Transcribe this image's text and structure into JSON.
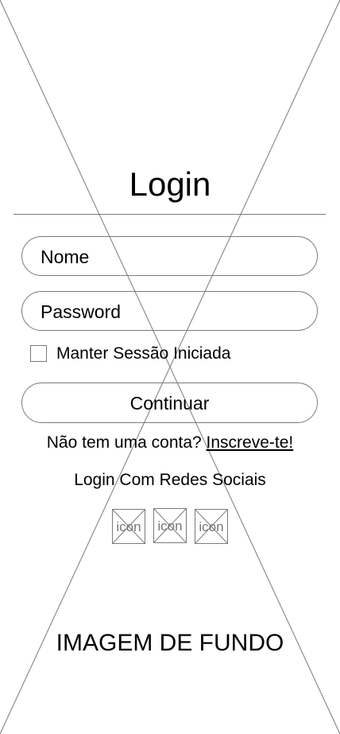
{
  "login": {
    "title": "Login",
    "name_field": {
      "value": "Nome"
    },
    "password_field": {
      "value": "Password"
    },
    "remember_me": {
      "label": "Manter Sessão Iniciada",
      "checked": false
    },
    "continue_button": {
      "label": "Continuar"
    },
    "signup": {
      "prompt": "Não tem uma conta?",
      "link_label": "Inscreve-te!"
    },
    "social": {
      "title": "Login Com Redes Sociais",
      "icons": [
        {
          "label": "icon",
          "icon_name": "placeholder-icon"
        },
        {
          "label": "icon",
          "icon_name": "placeholder-icon"
        },
        {
          "label": "icon",
          "icon_name": "placeholder-icon"
        }
      ]
    },
    "background": {
      "label": "IMAGEM DE FUNDO"
    }
  },
  "colors": {
    "stroke": "#7a7a7a",
    "icon_text": "#777777",
    "background": "#ffffff",
    "text": "#000000"
  }
}
